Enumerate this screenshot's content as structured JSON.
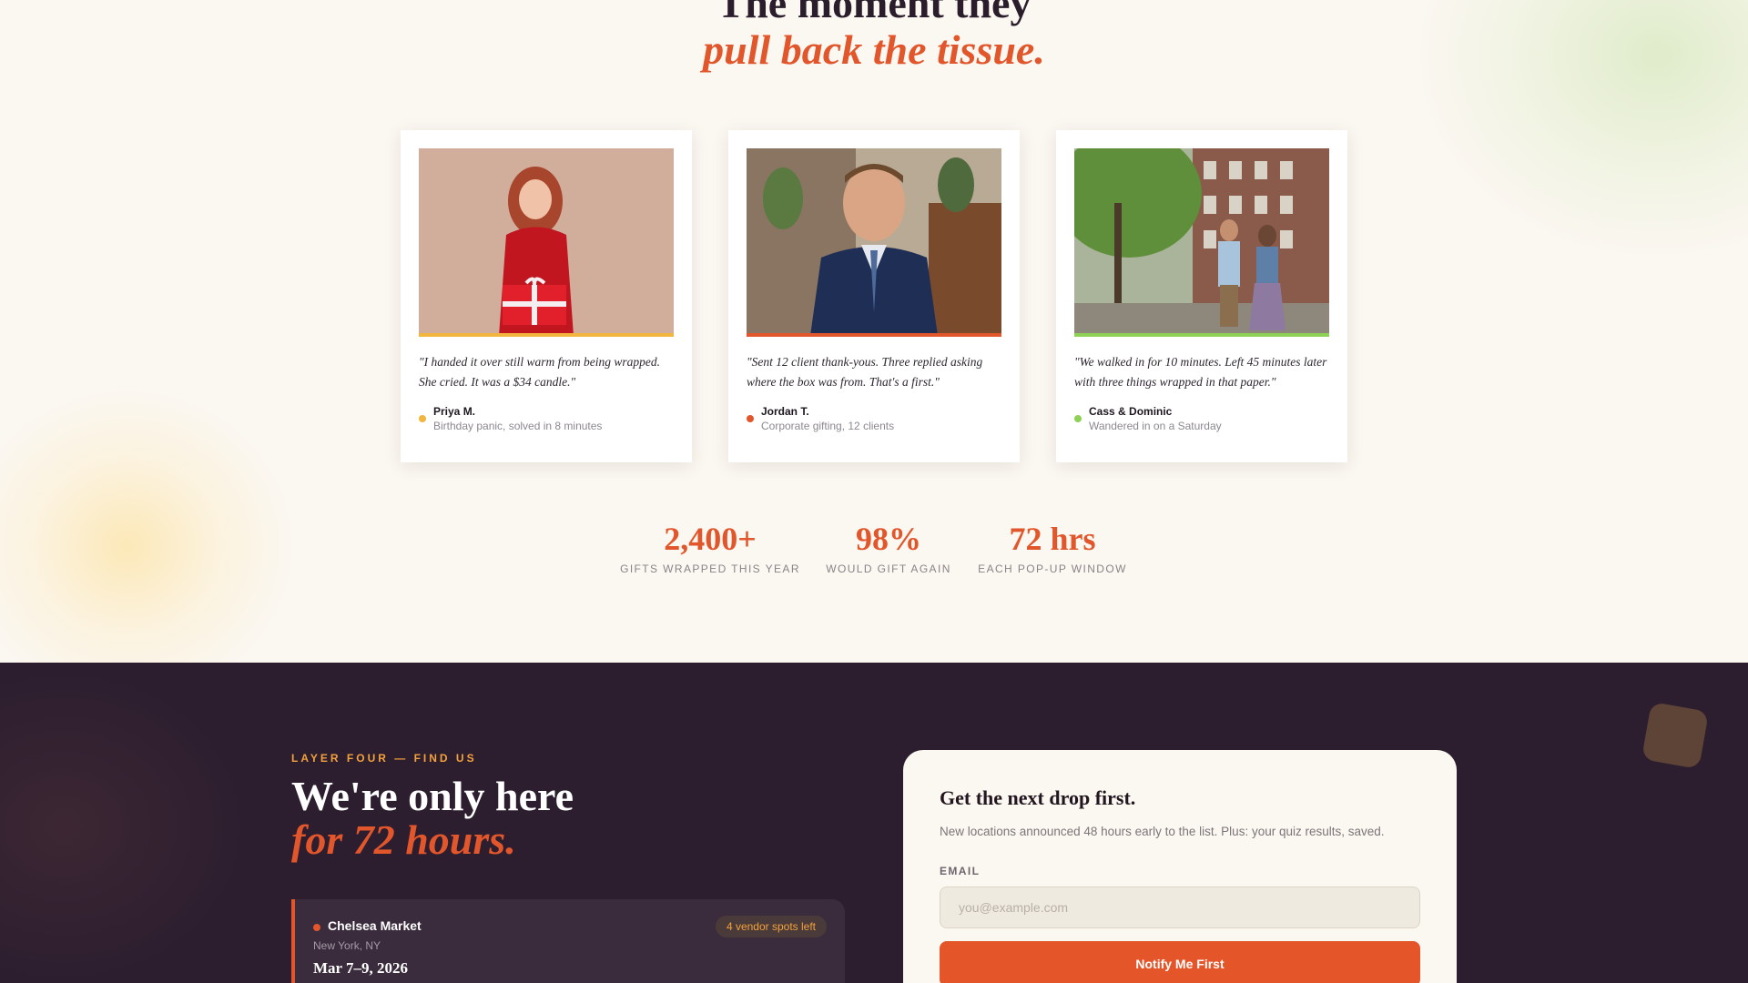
{
  "testimonials": {
    "heading_line1": "The moment they",
    "heading_line2": "pull back the tissue.",
    "cards": [
      {
        "quote": "\"I handed it over still warm from being wrapped. She cried. It was a $34 candle.\"",
        "name": "Priya M.",
        "detail": "Birthday panic, solved in 8 minutes",
        "accent": "#f2b53d",
        "photo_icon": "woman-with-gift-photo"
      },
      {
        "quote": "\"Sent 12 client thank-yous. Three replied asking where the box was from. That's a first.\"",
        "name": "Jordan T.",
        "detail": "Corporate gifting, 12 clients",
        "accent": "#e2562c",
        "photo_icon": "businessman-portrait-photo"
      },
      {
        "quote": "\"We walked in for 10 minutes. Left 45 minutes later with three things wrapped in that paper.\"",
        "name": "Cass & Dominic",
        "detail": "Wandered in on a Saturday",
        "accent": "#8fd155",
        "photo_icon": "couple-on-street-photo"
      }
    ]
  },
  "stats": [
    {
      "value": "2,400+",
      "label": "GIFTS WRAPPED THIS YEAR"
    },
    {
      "value": "98%",
      "label": "WOULD GIFT AGAIN"
    },
    {
      "value": "72 hrs",
      "label": "EACH POP-UP WINDOW"
    }
  ],
  "find_us": {
    "eyebrow": "LAYER FOUR — FIND US",
    "title_line1": "We're only here",
    "title_line2": "for 72 hours.",
    "location": {
      "name": "Chelsea Market",
      "city": "New York, NY",
      "dates": "Mar 7–9, 2026",
      "badge": "4 vendor spots left"
    }
  },
  "signup": {
    "title": "Get the next drop first.",
    "description": "New locations announced 48 hours early to the list. Plus: your quiz results, saved.",
    "email_label": "EMAIL",
    "email_placeholder": "you@example.com",
    "email_value": "",
    "button_label": "Notify Me First"
  },
  "colors": {
    "accent": "#e2562c",
    "dark_bg": "#2c1e2f",
    "cream_bg": "#fbf7f1",
    "gold": "#f2a13c"
  }
}
